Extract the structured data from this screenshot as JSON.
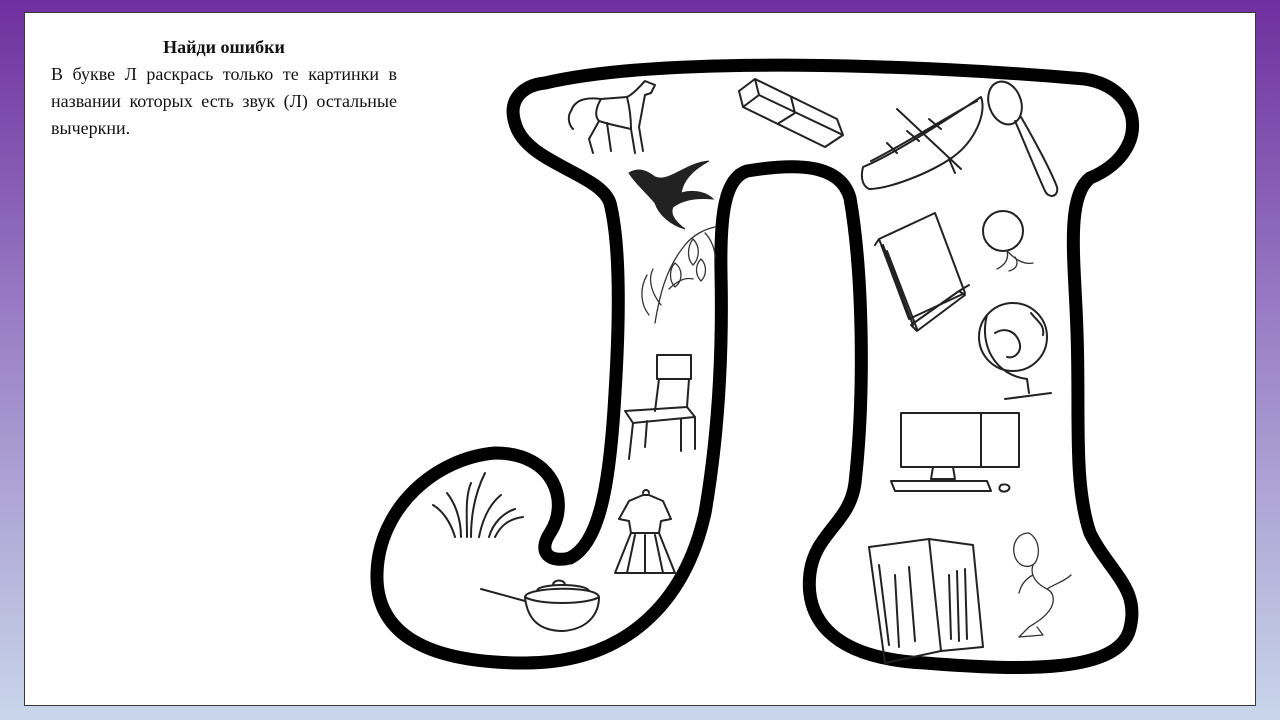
{
  "task": {
    "title": "Найди ошибки",
    "text": "В букве Л раскрась только те картинки в названии которых есть звук (Л) остальные вычеркни."
  },
  "pictures": [
    "horse",
    "eraser",
    "boat",
    "spoon",
    "swallow",
    "bellflower",
    "notepad",
    "balloon",
    "globe",
    "chair",
    "computer",
    "grass",
    "dress",
    "pencil-case",
    "mermaid",
    "frying-pan"
  ],
  "colors": {
    "outline": "#000000",
    "frame": "#6e2f9e"
  }
}
